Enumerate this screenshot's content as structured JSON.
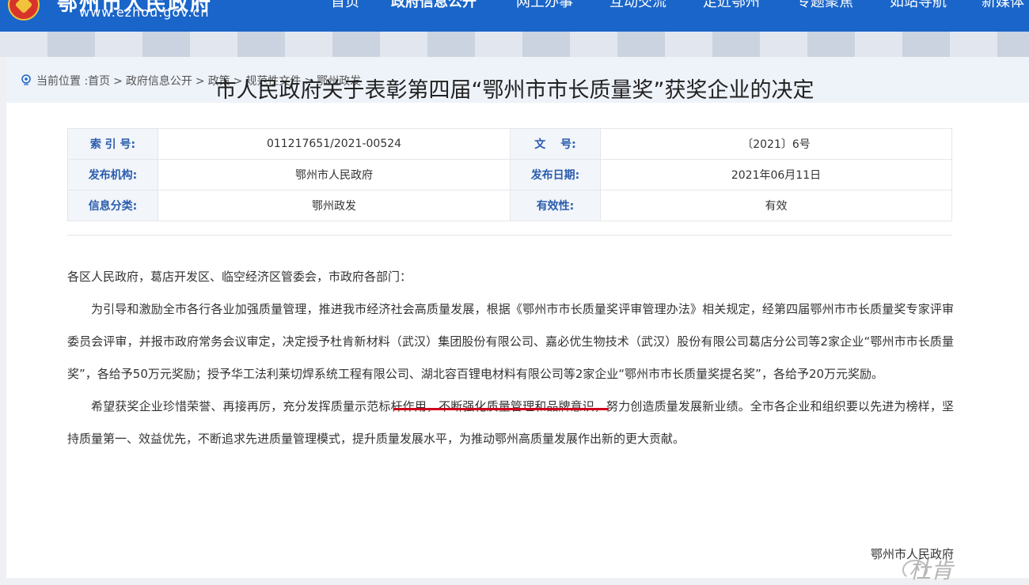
{
  "header": {
    "site_title": "鄂州市人民政府",
    "site_url": "www.ezhou.gov.cn",
    "nav": [
      "首页",
      "政府信息公开",
      "网上办事",
      "互动交流",
      "走近鄂州",
      "专题聚焦",
      "如站导航",
      "新媒体"
    ]
  },
  "breadcrumb": {
    "prefix": "当前位置 :",
    "items": [
      "首页",
      "政府信息公开",
      "政策",
      "规范性文件",
      "鄂州政发"
    ]
  },
  "article": {
    "title": "市人民政府关于表彰第四届“鄂州市市长质量奖”获奖企业的决定",
    "meta": [
      {
        "label1": "索 引 号:",
        "value1": "011217651/2021-00524",
        "label2": "文　 号:",
        "value2": "〔2021〕6号"
      },
      {
        "label1": "发布机构:",
        "value1": "鄂州市人民政府",
        "label2": "发布日期:",
        "value2": "2021年06月11日"
      },
      {
        "label1": "信息分类:",
        "value1": "鄂州政发",
        "label2": "有效性:",
        "value2": "有效"
      }
    ],
    "salutation": "各区人民政府，葛店开发区、临空经济区管委会，市政府各部门：",
    "para1": "为引导和激励全市各行各业加强质量管理，推进我市经济社会高质量发展，根据《鄂州市市长质量奖评审管理办法》相关规定，经第四届鄂州市市长质量奖专家评审委员会评审，并报市政府常务会议审定，决定授予杜肯新材料（武汉）集团股份有限公司、嘉必优生物技术（武汉）股份有限公司葛店分公司等2家企业“鄂州市市长质量奖”，各给予50万元奖励；授予华工法利莱切焊系统工程有限公司、湖北容百锂电材料有限公司等2家企业“鄂州市市长质量奖提名奖”，各给予20万元奖励。",
    "para2": "希望获奖企业珍惜荣誉、再接再厉，充分发挥质量示范标杆作用，不断强化质量管理和品牌意识，努力创造质量发展新业绩。全市各企业和组织要以先进为榜样，坚持质量第一、效益优先，不断追求先进质量管理模式，提升质量发展水平，为推动鄂州高质量发展作出新的更大贡献。",
    "signoff": "鄂州市人民政府"
  },
  "watermark": "杜肯",
  "colors": {
    "header": "#1a65c9",
    "label": "#2a5cae",
    "highlight": "#d0021b"
  }
}
